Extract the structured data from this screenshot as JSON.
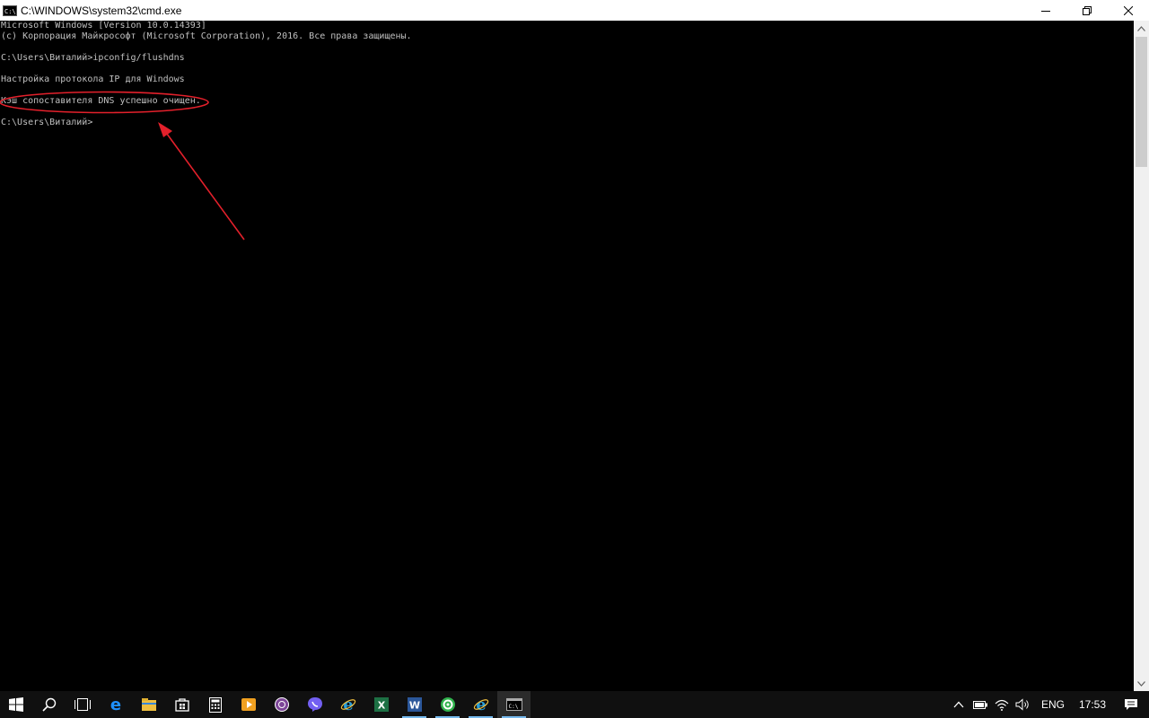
{
  "window": {
    "title": "C:\\WINDOWS\\system32\\cmd.exe",
    "icon_text": "C:\\"
  },
  "console": {
    "lines": [
      "Microsoft Windows [Version 10.0.14393]",
      "(c) Корпорация Майкрософт (Microsoft Corporation), 2016. Все права защищены.",
      "",
      "C:\\Users\\Виталий>ipconfig/flushdns",
      "",
      "Настройка протокола IP для Windows",
      "",
      "Кэш сопоставителя DNS успешно очищен.",
      "",
      "C:\\Users\\Виталий>"
    ],
    "highlight_color": "#e3202b"
  },
  "taskbar": {
    "apps": [
      {
        "name": "start",
        "icon": "windows-logo-icon"
      },
      {
        "name": "search",
        "icon": "search-icon"
      },
      {
        "name": "task-view",
        "icon": "task-view-icon"
      },
      {
        "name": "edge",
        "icon": "edge-icon"
      },
      {
        "name": "explorer",
        "icon": "folder-icon"
      },
      {
        "name": "store",
        "icon": "store-icon"
      },
      {
        "name": "calculator",
        "icon": "calculator-icon"
      },
      {
        "name": "media",
        "icon": "media-player-icon"
      },
      {
        "name": "tor",
        "icon": "tor-icon"
      },
      {
        "name": "viber",
        "icon": "viber-icon"
      },
      {
        "name": "ie",
        "icon": "internet-explorer-icon"
      },
      {
        "name": "excel",
        "icon": "excel-icon"
      },
      {
        "name": "word",
        "icon": "word-icon"
      },
      {
        "name": "browser",
        "icon": "green-browser-icon"
      },
      {
        "name": "ie2",
        "icon": "internet-explorer-icon"
      },
      {
        "name": "cmd",
        "icon": "command-prompt-icon"
      }
    ],
    "tray": {
      "language": "ENG",
      "time": "17:53"
    },
    "accent": "#76b9ed"
  }
}
